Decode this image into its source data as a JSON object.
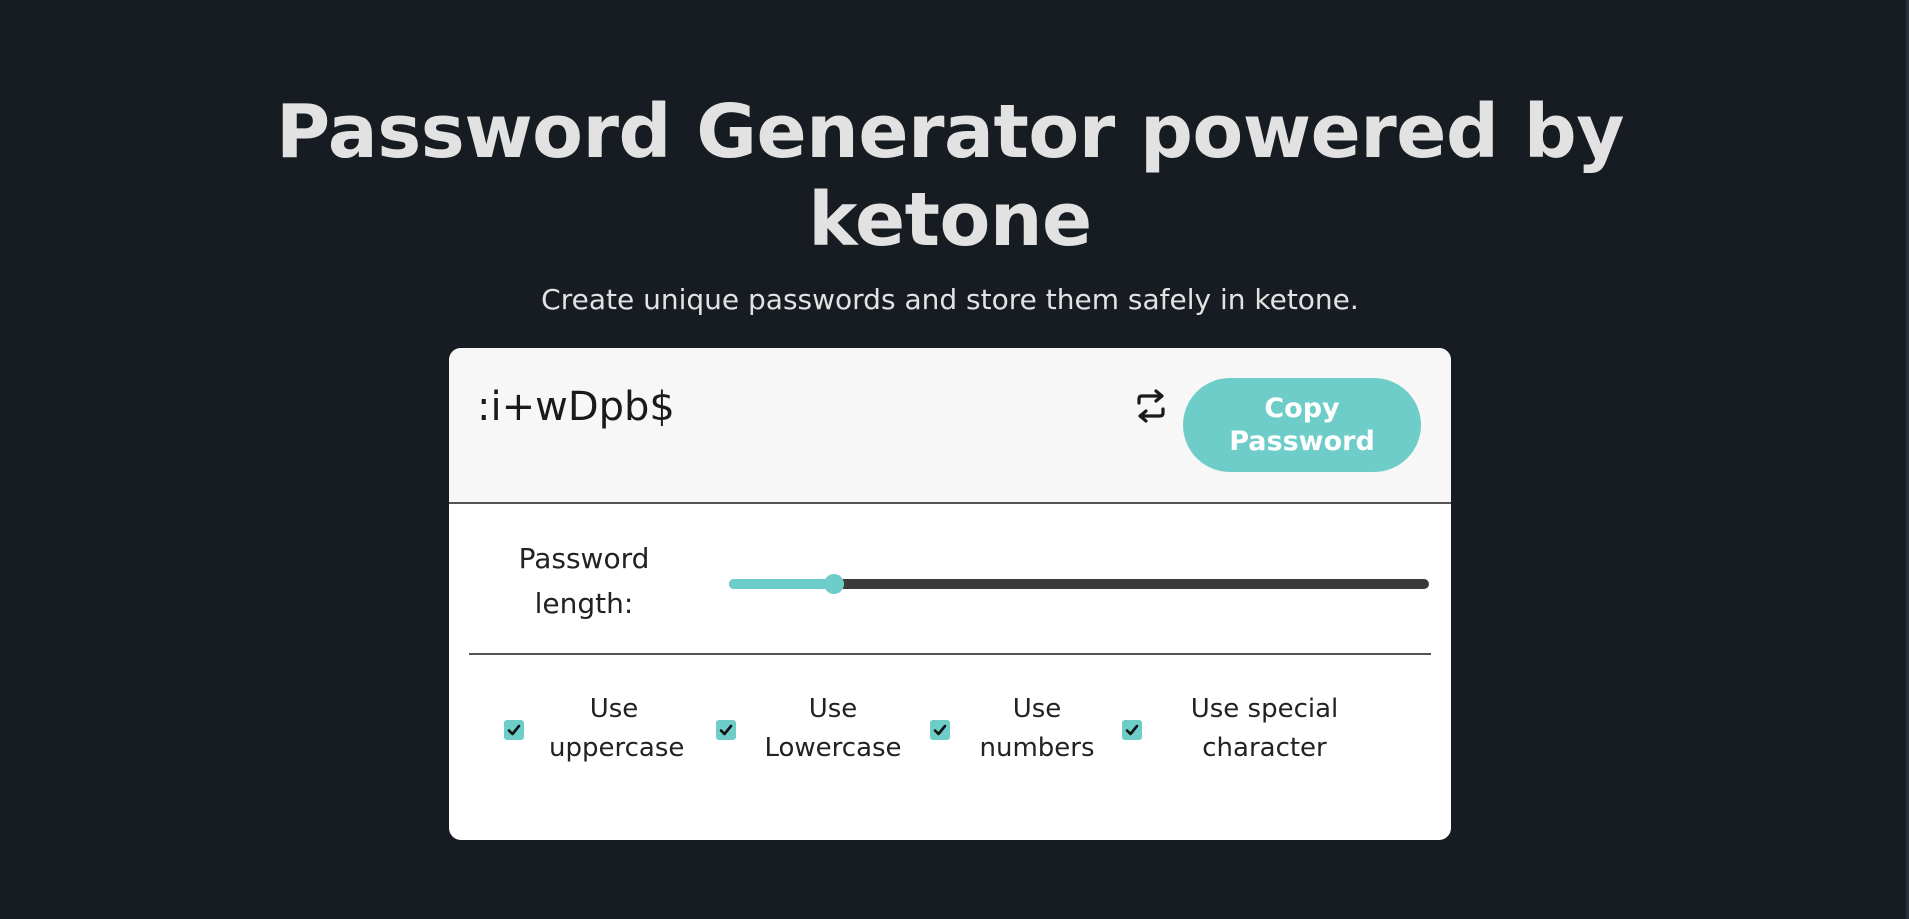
{
  "header": {
    "title_line1": "Password Generator powered by",
    "title_line2": "ketone",
    "subtitle": "Create unique passwords and store them safely in ketone."
  },
  "generator": {
    "password": ":i+wDpb$",
    "refresh_icon": "refresh-icon",
    "copy_button_line1": "Copy",
    "copy_button_line2": "Password",
    "length_label_line1": "Password",
    "length_label_line2": "length:",
    "length_slider_fraction": 0.15
  },
  "options": [
    {
      "line1": "Use",
      "line2": "uppercase",
      "checked": true
    },
    {
      "line1": "Use",
      "line2": "Lowercase",
      "checked": true
    },
    {
      "line1": "Use",
      "line2": "numbers",
      "checked": true
    },
    {
      "line1": "Use special",
      "line2": "character",
      "checked": true
    }
  ],
  "colors": {
    "background": "#171b22",
    "accent": "#6ecdc8",
    "card": "#ffffff",
    "card_top": "#f7f7f7"
  }
}
